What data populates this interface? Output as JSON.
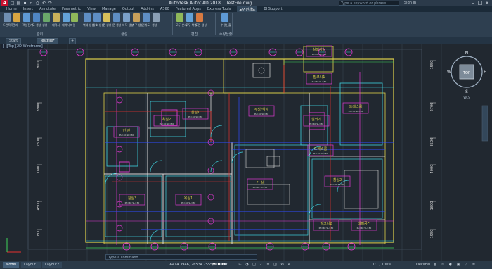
{
  "app": {
    "logo": "A",
    "title": "Autodesk AutoCAD 2018",
    "filename": "TestFile.dwg",
    "search_placeholder": "Type a keyword or phrase",
    "user": "Sign In",
    "qat_icons": [
      "new-icon",
      "open-icon",
      "save-icon",
      "save-as-icon",
      "plot-icon",
      "undo-icon",
      "redo-icon"
    ]
  },
  "ribbon": {
    "tabs": [
      "Home",
      "Insert",
      "Annotate",
      "Parametric",
      "View",
      "Manage",
      "Output",
      "Add-ins",
      "A360",
      "Featured Apps",
      "Express Tools",
      "도면전개도",
      "BI Support"
    ],
    "active_tab": "도면전개도",
    "buttons": [
      {
        "label": "도면목록",
        "color": "#6f8fb2"
      },
      {
        "label": "관리",
        "color": "#d7a541"
      },
      {
        "label": "객실전개",
        "color": "#5e9ad6"
      },
      {
        "label": "도 생성",
        "color": "#4f86c4"
      },
      {
        "label": "생성",
        "color": "#6aa86a"
      },
      {
        "label": "내역서",
        "color": "#c8b05a"
      },
      {
        "label": "내역서",
        "color": "#63a2d8"
      },
      {
        "label": "파일",
        "color": "#8fb85a"
      },
      {
        "label": "벽체 생성",
        "color": "#5e8ec4"
      },
      {
        "label": "창호 생성",
        "color": "#5e8ec4"
      },
      {
        "label": "문 생성",
        "color": "#d7c05a"
      },
      {
        "label": "문 생성",
        "color": "#5e8ec4"
      },
      {
        "label": "바닥 생성",
        "color": "#7aa0c8"
      },
      {
        "label": "가구 생성",
        "color": "#c8a05a"
      },
      {
        "label": "전개도",
        "color": "#5e8ec4"
      },
      {
        "label": "생성",
        "color": "#8a9fb5"
      },
      {
        "label": "모두 분리",
        "color": "#8fb85a"
      },
      {
        "label": "모두 복원",
        "color": "#63a2d8"
      },
      {
        "label": "도면 생성",
        "color": "#d77a41"
      },
      {
        "label": "수량산출",
        "color": "#5e9ad6"
      }
    ],
    "panels": [
      "관리",
      "생성",
      "편집",
      "수량산출"
    ]
  },
  "file_tabs": [
    "Start",
    "TestFile*"
  ],
  "viewport": {
    "label": "[-][Top][2D Wireframe]"
  },
  "viewcube": {
    "center": "TOP",
    "n": "N",
    "s": "S",
    "e": "E",
    "w": "W",
    "wcs": "WCS"
  },
  "rooms": [
    {
      "name": "실외기실",
      "area": "PL=50  PL=60"
    },
    {
      "name": "발코니1",
      "area": "PL=40  SL=30"
    },
    {
      "name": "드레스룸",
      "area": "PL=50  SL=30"
    },
    {
      "name": "실외기",
      "area": "PL=40  SL=30"
    },
    {
      "name": "침실2",
      "area": "PL=40  SL=30"
    },
    {
      "name": "침실3",
      "area": "PL=40  SL=30"
    },
    {
      "name": "욕실1",
      "area": "PL=40  SL=30"
    },
    {
      "name": "거 실",
      "area": "PL=40  SL=30"
    },
    {
      "name": "주방/식당",
      "area": "PL=40  SL=30"
    },
    {
      "name": "침실1",
      "area": "PL=40  SL=30"
    },
    {
      "name": "드레스룸",
      "area": "PL=40  SL=30"
    },
    {
      "name": "욕실2",
      "area": "PL=40  SL=30"
    },
    {
      "name": "발코니2",
      "area": "PL=40  SL=30"
    },
    {
      "name": "대피공간",
      "area": "PL=40  SL=30"
    },
    {
      "name": "현 관",
      "area": "PL=40  SL=30"
    }
  ],
  "dimensions": {
    "left": [
      "800",
      "3900",
      "2800",
      "1800",
      "4500",
      "1800"
    ],
    "right": [
      "1550",
      "2700",
      "3500",
      "4000",
      "1600",
      "1950"
    ]
  },
  "command_line": {
    "placeholder": "Type a command"
  },
  "status": {
    "layouts": [
      "Model",
      "Layout1",
      "Layout2"
    ],
    "active_layout": "Model",
    "coordinates": "-6414.3946, 26534.2555, 0.0000",
    "mode": "MODEL",
    "scale": "1:1 / 100%",
    "units": "Decimal"
  },
  "colors": {
    "wall_yellow": "#e0d24a",
    "cyan": "#3fd3e0",
    "magenta": "#e23ad3",
    "red": "#e8312e",
    "blue": "#2f4bff",
    "green": "#3fd35a",
    "white": "#d9d9d9"
  }
}
